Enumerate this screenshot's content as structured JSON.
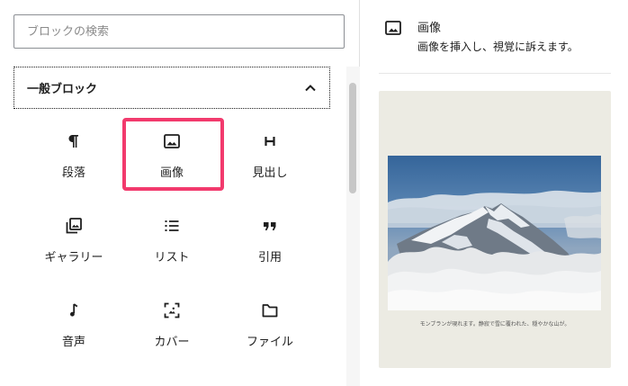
{
  "search": {
    "placeholder": "ブロックの検索"
  },
  "category": {
    "title": "一般ブロック"
  },
  "blocks": [
    {
      "label": "段落",
      "icon": "paragraph-icon"
    },
    {
      "label": "画像",
      "icon": "image-icon"
    },
    {
      "label": "見出し",
      "icon": "heading-icon"
    },
    {
      "label": "ギャラリー",
      "icon": "gallery-icon"
    },
    {
      "label": "リスト",
      "icon": "list-icon"
    },
    {
      "label": "引用",
      "icon": "quote-icon"
    },
    {
      "label": "音声",
      "icon": "audio-icon"
    },
    {
      "label": "カバー",
      "icon": "cover-icon"
    },
    {
      "label": "ファイル",
      "icon": "file-icon"
    }
  ],
  "info": {
    "title": "画像",
    "description": "画像を挿入し、視覚に訴えます。"
  },
  "preview": {
    "caption": "モンブランが現れます。静寂で雪に覆われた、穏やかな山が。"
  },
  "colors": {
    "highlight": "#f23a6d",
    "text": "#1e1e1e",
    "preview_bg": "#ecebe3"
  }
}
